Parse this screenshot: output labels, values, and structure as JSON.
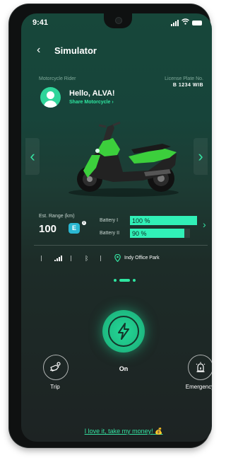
{
  "status_bar": {
    "time": "9:41"
  },
  "header": {
    "title": "Simulator"
  },
  "rider": {
    "label": "Motorcycle Rider",
    "greeting": "Hello, ALVA!",
    "share": "Share Motorcycle"
  },
  "plate": {
    "label": "License Plate No.",
    "value": "B 1234 WIB"
  },
  "range": {
    "label": "Est. Range (km)",
    "value": "100",
    "badge": "E"
  },
  "batteries": [
    {
      "label": "Battery I",
      "value": "100 %",
      "level": 1.0
    },
    {
      "label": "Battery II",
      "value": "90 %",
      "level": 0.9
    }
  ],
  "status_row": {
    "location": "Indy Office Park"
  },
  "pager": {
    "count": 3,
    "active_index": 1
  },
  "power": {
    "label": "On"
  },
  "actions": {
    "trip": "Trip",
    "emergency": "Emergency"
  },
  "footer": {
    "love": "I love it, take my money!",
    "money_icon": "💰"
  },
  "colors": {
    "accent": "#2ee6a0",
    "battery_fill": "#31f0b7",
    "badge": "#2ab7d2",
    "scooter_green": "#3ccf3c"
  }
}
